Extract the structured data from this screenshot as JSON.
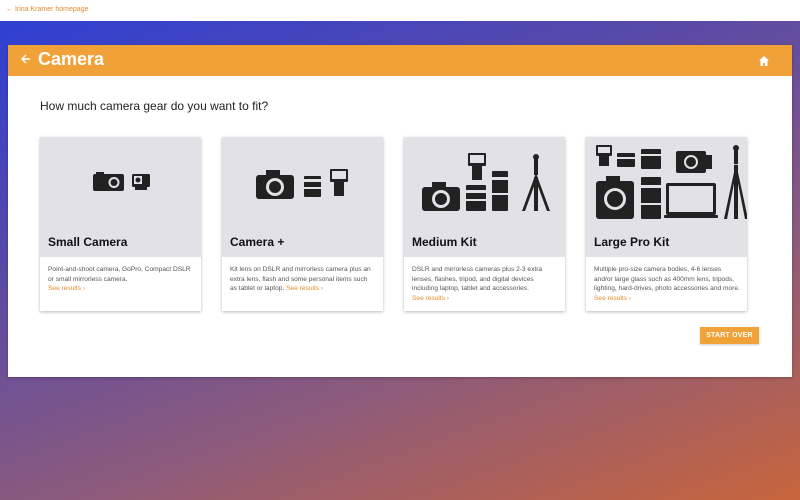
{
  "topbar": {
    "back_link": "← Irina Kramer homepage"
  },
  "header": {
    "title": "Camera",
    "back_icon": "arrow-left-icon",
    "home_icon": "home-icon"
  },
  "question": "How much camera gear do you want to fit?",
  "tiles": [
    {
      "name": "Small Camera",
      "desc": "Point-and-shoot camera, GoPro, Compact DSLR or small mirrorless camera.",
      "link": "See results ›"
    },
    {
      "name": "Camera +",
      "desc": "Kit lens on DSLR and mirrorless camera plus an extra lens, flash and some personal items such as tablet or laptop.",
      "link": "See results ›"
    },
    {
      "name": "Medium Kit",
      "desc": "DSLR and mirrorless cameras plus 2-3 extra lenses, flashes, tripod, and digital devices including laptop, tablet and accessories.",
      "link": "See results ›"
    },
    {
      "name": "Large Pro Kit",
      "desc": "Multiple pro-size camera bodies, 4-6 lenses and/or large glass such as 400mm lens, tripods, lighting, hard-drives, photo accessories and more.",
      "link": "See results ›"
    }
  ],
  "start_over": "START OVER",
  "colors": {
    "accent": "#f0a238",
    "link": "#e88a2a",
    "tile_bg": "#e2e2e6"
  }
}
